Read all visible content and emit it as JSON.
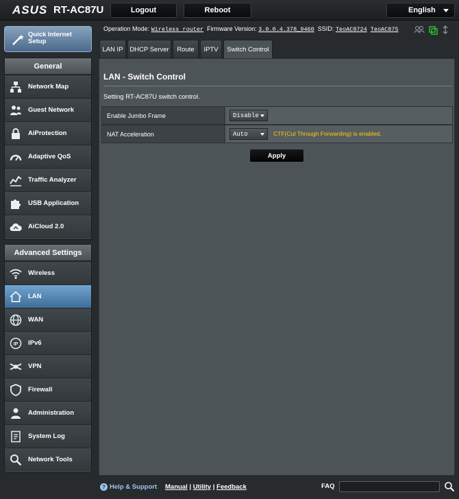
{
  "header": {
    "brand": "ASUS",
    "model": "RT-AC87U",
    "logout": "Logout",
    "reboot": "Reboot",
    "language": "English"
  },
  "sidebar": {
    "qis": "Quick Internet Setup",
    "general_title": "General",
    "general_items": [
      {
        "label": "Network Map",
        "icon": "network-map-icon"
      },
      {
        "label": "Guest Network",
        "icon": "guest-network-icon"
      },
      {
        "label": "AiProtection",
        "icon": "lock-icon"
      },
      {
        "label": "Adaptive QoS",
        "icon": "gauge-icon"
      },
      {
        "label": "Traffic Analyzer",
        "icon": "chart-icon"
      },
      {
        "label": "USB Application",
        "icon": "puzzle-icon"
      },
      {
        "label": "AiCloud 2.0",
        "icon": "cloud-icon"
      }
    ],
    "advanced_title": "Advanced Settings",
    "advanced_items": [
      {
        "label": "Wireless",
        "icon": "wifi-icon"
      },
      {
        "label": "LAN",
        "icon": "home-icon"
      },
      {
        "label": "WAN",
        "icon": "globe-icon"
      },
      {
        "label": "IPv6",
        "icon": "ipv6-icon"
      },
      {
        "label": "VPN",
        "icon": "vpn-icon"
      },
      {
        "label": "Firewall",
        "icon": "shield-icon"
      },
      {
        "label": "Administration",
        "icon": "user-icon"
      },
      {
        "label": "System Log",
        "icon": "log-icon"
      },
      {
        "label": "Network Tools",
        "icon": "tools-icon"
      }
    ],
    "active": "LAN"
  },
  "status": {
    "mode_label": "Operation Mode:",
    "mode_value": "Wireless router",
    "fw_label": "Firmware Version:",
    "fw_value": "3.0.0.4.378_9460",
    "ssid_label": "SSID:",
    "ssid1": "TeoAC8724",
    "ssid2": "TeoAC875"
  },
  "tabs": [
    "LAN IP",
    "DHCP Server",
    "Route",
    "IPTV",
    "Switch Control"
  ],
  "active_tab": "Switch Control",
  "panel": {
    "title": "LAN - Switch Control",
    "description": "Setting RT-AC87U switch control.",
    "rows": [
      {
        "label": "Enable Jumbo Frame",
        "value": "Disable",
        "note": ""
      },
      {
        "label": "NAT Acceleration",
        "value": "Auto",
        "note": "CTF(Cut Through Forwarding) is enabled."
      }
    ],
    "apply": "Apply"
  },
  "footer": {
    "help": "Help & Support",
    "manual": "Manual",
    "utility": "Utility",
    "feedback": "Feedback",
    "sep": "|",
    "faq": "FAQ"
  },
  "colors": {
    "accent": "#4f80ab",
    "note": "#ffcc00",
    "background": "#272b2e"
  }
}
